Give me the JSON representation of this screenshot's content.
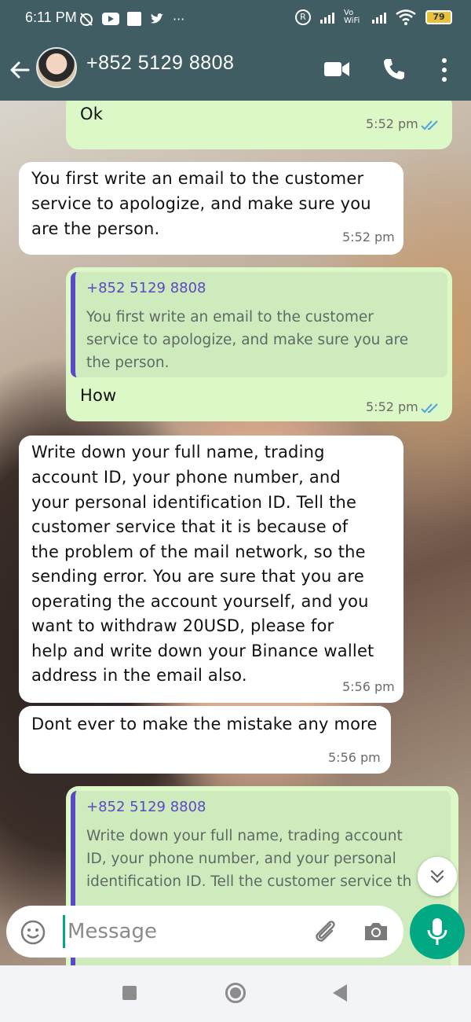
{
  "status_bar": {
    "time": "6:11 PM",
    "more": "···",
    "registered": "R",
    "volte": "Vo WiFi",
    "battery": "79"
  },
  "header": {
    "contact_name": "+852 5129 8808"
  },
  "messages": [
    {
      "type": "outgoing",
      "text": "Ok",
      "time": "5:52 pm",
      "status": "read"
    },
    {
      "type": "incoming",
      "lines": [
        "You first write an email to the customer",
        "service to apologize, and make sure you",
        "are the person."
      ],
      "time": "5:52 pm"
    },
    {
      "type": "outgoing",
      "quote_name": "+852 5129 8808",
      "quote_lines": [
        "You first write an email to the customer",
        "service to apologize, and make sure you are",
        "the person."
      ],
      "text": "How",
      "time": "5:52 pm",
      "status": "read"
    },
    {
      "type": "incoming",
      "lines": [
        "Write down your full name, trading",
        "account ID, your phone number, and",
        "your personal identification ID. Tell the",
        "customer service that it is because of",
        "the problem of the mail network, so the",
        "sending error. You are sure that you are",
        "operating the account yourself, and you",
        "want to withdraw 20USD, please for",
        "help and write down your Binance wallet",
        "address in the email also."
      ],
      "time": "5:56 pm"
    },
    {
      "type": "incoming",
      "text": "Dont ever to make the mistake any more",
      "time": "5:56 pm"
    },
    {
      "type": "outgoing",
      "quote_name": "+852 5129 8808",
      "quote_lines": [
        "Write down your full name, trading account",
        "ID, your phone number, and your personal",
        "identification ID. Tell the customer service th"
      ]
    }
  ],
  "composer": {
    "placeholder": "Message"
  },
  "colors": {
    "header_bg": "#3f5d63",
    "outgoing_bubble": "#dcf8c6",
    "incoming_bubble": "#ffffff",
    "accent": "#00a884",
    "quote_author": "#5a49c4",
    "read_ticks": "#4fa3e0"
  }
}
